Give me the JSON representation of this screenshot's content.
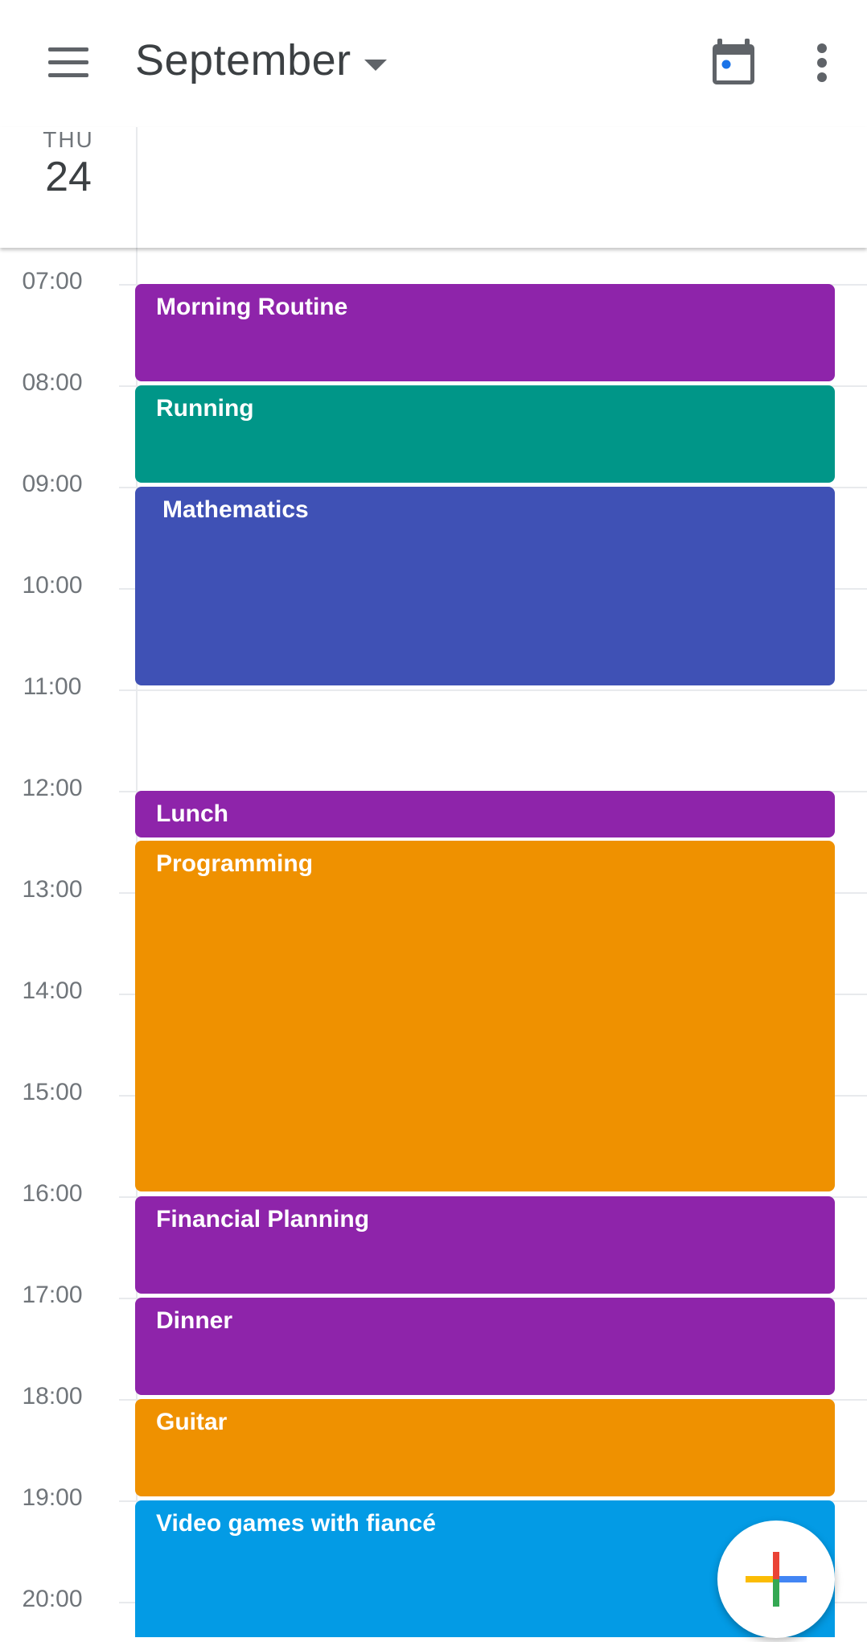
{
  "header": {
    "month_label": "September",
    "icons": {
      "menu": "menu-icon",
      "dropdown": "caret-down-icon",
      "today": "calendar-today-icon",
      "more": "more-vert-icon"
    }
  },
  "day": {
    "weekday": "THU",
    "date": "24"
  },
  "hours": [
    "07:00",
    "08:00",
    "09:00",
    "10:00",
    "11:00",
    "12:00",
    "13:00",
    "14:00",
    "15:00",
    "16:00",
    "17:00",
    "18:00",
    "19:00",
    "20:00"
  ],
  "events": [
    {
      "title": "Morning Routine",
      "color": "#8e24aa"
    },
    {
      "title": "Running",
      "color": "#009688"
    },
    {
      "title": "Mathematics",
      "color": "#3f51b5"
    },
    {
      "title": "Lunch",
      "color": "#8e24aa"
    },
    {
      "title": "Programming",
      "color": "#ef9100"
    },
    {
      "title": "Financial Planning",
      "color": "#8e24aa"
    },
    {
      "title": "Dinner",
      "color": "#8e24aa"
    },
    {
      "title": "Guitar",
      "color": "#ef9100"
    },
    {
      "title": "Video games with fiancé",
      "color": "#039be5"
    }
  ],
  "fab": {
    "icon": "add-event-icon",
    "colors": [
      "#ea4335",
      "#4285f4",
      "#34a853",
      "#fbbc04"
    ]
  }
}
